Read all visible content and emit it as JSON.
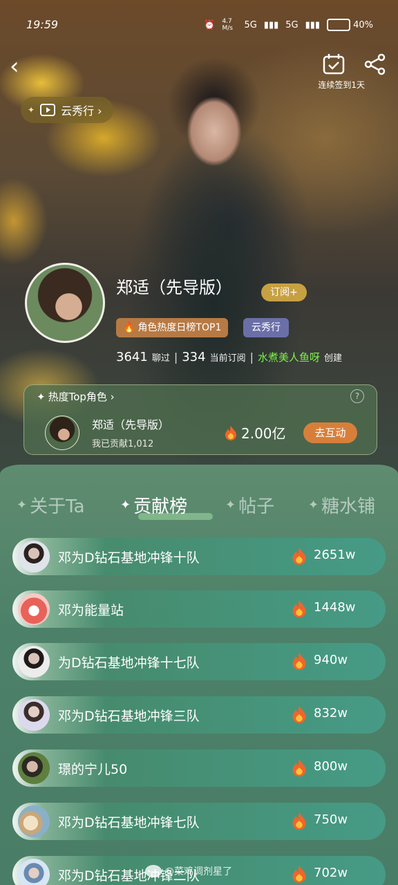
{
  "status_bar": {
    "time": "19:59",
    "speed": "4.7 M/s",
    "signal1": "5G",
    "signal2": "5G",
    "battery": "40%"
  },
  "header": {
    "checkin_label": "连续签到1天"
  },
  "yunxiu_pill": {
    "label": "云秀行 ›"
  },
  "profile": {
    "name": "郑适（先导版）",
    "subscribe": "订阅+",
    "tag_hot": "角色热度日榜TOP1",
    "tag_show": "云秀行",
    "chats_count": "3641",
    "chats_label": "聊过",
    "subs_count": "334",
    "subs_label": "当前订阅",
    "creator_name": "水煮美人鱼呀",
    "creator_label": "创建"
  },
  "top_card": {
    "header": "热度Top角色 ›",
    "help": "?",
    "name": "郑适（先导版）",
    "contribution": "我已贡献1,012",
    "heat": "2.00亿",
    "button": "去互动"
  },
  "tabs": [
    {
      "label": "关于Ta",
      "active": false
    },
    {
      "label": "贡献榜",
      "active": true
    },
    {
      "label": "帖子",
      "active": false
    },
    {
      "label": "糖水铺",
      "active": false
    }
  ],
  "ranking": [
    {
      "name": "邓为D钻石基地冲锋十队",
      "value": "2651w"
    },
    {
      "name": "邓为能量站",
      "value": "1448w"
    },
    {
      "name": "为D钻石基地冲锋十七队",
      "value": "940w"
    },
    {
      "name": "邓为D钻石基地冲锋三队",
      "value": "832w"
    },
    {
      "name": "璟的宁儿50",
      "value": "800w"
    },
    {
      "name": "邓为D钻石基地冲锋七队",
      "value": "750w"
    },
    {
      "name": "邓为D钻石基地冲锋二队",
      "value": "702w"
    }
  ],
  "watermark": "@菜鸡调剂星了",
  "colors": {
    "panel_green": "#4c8068",
    "row_teal": "#469b86",
    "subscribe_gold": "#c7a042",
    "interact_orange": "#d77f3a",
    "creator_green": "#7cf04a"
  }
}
